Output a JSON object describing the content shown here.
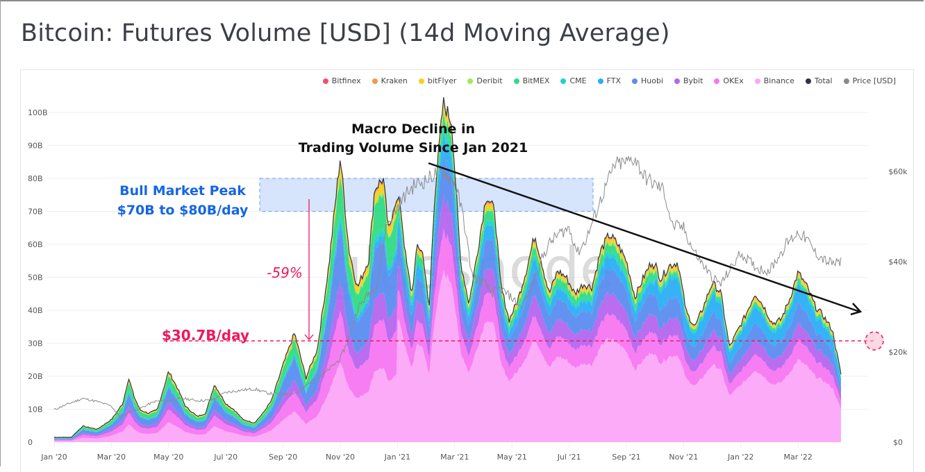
{
  "page": {
    "title": "Bitcoin: Futures Volume [USD] (14d Moving Average)",
    "watermark": "glassnode"
  },
  "legend": [
    {
      "label": "Bitfinex",
      "color": "#f0506e"
    },
    {
      "label": "Kraken",
      "color": "#f7964a"
    },
    {
      "label": "bitFlyer",
      "color": "#f9cf1f"
    },
    {
      "label": "Deribit",
      "color": "#a3ea4f"
    },
    {
      "label": "BitMEX",
      "color": "#2fdc83"
    },
    {
      "label": "CME",
      "color": "#1fd3c6"
    },
    {
      "label": "FTX",
      "color": "#2aaff5"
    },
    {
      "label": "Huobi",
      "color": "#5b8df0"
    },
    {
      "label": "Bybit",
      "color": "#b565ee"
    },
    {
      "label": "OKEx",
      "color": "#f776f2"
    },
    {
      "label": "Binance",
      "color": "#fba6f7"
    },
    {
      "label": "Total",
      "color": "#2f3444"
    },
    {
      "label": "Price [USD]",
      "color": "#8a8a8a"
    }
  ],
  "annotations": {
    "macro_line1": "Macro Decline in",
    "macro_line2": "Trading Volume Since Jan 2021",
    "bull_line1": "Bull Market Peak",
    "bull_line2": "$70B to $80B/day",
    "drop_pct": "-59%",
    "current_level": "$30.7B/day",
    "bull_band_range_B": [
      70,
      80
    ],
    "current_level_B": 30.7
  },
  "chart_data": {
    "type": "area",
    "stacked": true,
    "title": "Bitcoin: Futures Volume [USD] (14d Moving Average)",
    "xlabel": "",
    "ylabel": "",
    "x_ticks": [
      "Jan '20",
      "Mar '20",
      "May '20",
      "Jul '20",
      "Sep '20",
      "Nov '20",
      "Jan '21",
      "Mar '21",
      "May '21",
      "Jul '21",
      "Sep '21",
      "Nov '21",
      "Jan '22",
      "Mar '22"
    ],
    "y_ticks_left": [
      "0",
      "10B",
      "20B",
      "30B",
      "40B",
      "50B",
      "60B",
      "70B",
      "80B",
      "90B",
      "100B"
    ],
    "y_ticks_right": [
      "$0",
      "$20k",
      "$40k",
      "$60k"
    ],
    "ylim_left_B": [
      0,
      100
    ],
    "ylim_right_usd_k": [
      0,
      70
    ],
    "x_month_range": [
      0,
      27.5
    ],
    "grid": true,
    "legend_position": "top-right",
    "total_volume_B": {
      "x_month": [
        0,
        0.6,
        1.0,
        1.5,
        2.0,
        2.4,
        2.6,
        2.8,
        3.0,
        3.3,
        3.6,
        4.0,
        4.3,
        4.6,
        4.8,
        5.0,
        5.3,
        5.6,
        6.0,
        6.3,
        6.6,
        7.0,
        7.3,
        7.6,
        8.0,
        8.4,
        8.8,
        9.2,
        9.6,
        10.0,
        10.3,
        10.6,
        11.0,
        11.2,
        11.5,
        11.7,
        11.9,
        12.1,
        12.3,
        12.5,
        12.7,
        12.9,
        13.1,
        13.3,
        13.6,
        13.9,
        14.2,
        14.5,
        14.8,
        15.1,
        15.4,
        15.6,
        15.9,
        16.2,
        16.5,
        16.8,
        17.0,
        17.3,
        17.6,
        17.9,
        18.2,
        18.5,
        18.8,
        19.1,
        19.4,
        19.7,
        20.0,
        20.3,
        20.6,
        20.9,
        21.2,
        21.5,
        21.8,
        22.1,
        22.4,
        22.7,
        23.0,
        23.3,
        23.6,
        23.9,
        24.2,
        24.5,
        24.8,
        25.1,
        25.4,
        25.7,
        26.0,
        26.3,
        26.6,
        26.9,
        27.2,
        27.5
      ],
      "values": [
        1.5,
        1.5,
        5,
        4,
        7,
        12,
        20,
        14,
        10,
        9,
        10,
        22,
        17,
        11,
        9.5,
        8,
        9,
        18,
        12,
        10,
        7,
        6,
        9,
        13,
        24,
        34,
        20,
        29,
        55,
        89,
        60,
        48,
        57,
        79,
        82,
        65,
        75,
        72,
        55,
        45,
        60,
        57,
        40,
        75,
        103,
        97,
        55,
        42,
        58,
        75,
        70,
        48,
        37,
        43,
        52,
        63,
        56,
        45,
        52,
        50,
        45,
        48,
        47,
        58,
        63,
        60,
        55,
        44,
        50,
        55,
        48,
        52,
        53,
        38,
        34,
        40,
        47,
        44,
        28,
        33,
        38,
        44,
        40,
        35,
        36,
        42,
        50,
        46,
        40,
        37,
        33,
        20
      ]
    },
    "layer_shares": [
      {
        "name": "Binance",
        "share": 0.5
      },
      {
        "name": "OKEx",
        "share": 0.12
      },
      {
        "name": "Bybit",
        "share": 0.1
      },
      {
        "name": "Huobi",
        "share": 0.12
      },
      {
        "name": "FTX",
        "share": 0.06
      },
      {
        "name": "CME",
        "share": 0.02
      },
      {
        "name": "BitMEX",
        "share": 0.04
      },
      {
        "name": "Deribit",
        "share": 0.01
      },
      {
        "name": "bitFlyer",
        "share": 0.02
      },
      {
        "name": "Kraken",
        "share": 0.005
      },
      {
        "name": "Bitfinex",
        "share": 0.005
      }
    ],
    "price_usd_k": {
      "x_month": [
        0,
        0.5,
        1.0,
        1.5,
        2.0,
        2.3,
        2.5,
        2.7,
        3.0,
        3.5,
        4.0,
        4.5,
        5.0,
        5.5,
        6.0,
        6.5,
        7.0,
        7.5,
        8.0,
        8.5,
        9.0,
        9.5,
        10.0,
        10.3,
        10.6,
        11.0,
        11.3,
        11.6,
        12.0,
        12.3,
        12.6,
        13.0,
        13.3,
        13.6,
        14.0,
        14.3,
        14.6,
        14.8,
        15.0,
        15.3,
        15.6,
        16.0,
        16.3,
        16.6,
        17.0,
        17.3,
        17.6,
        18.0,
        18.3,
        18.6,
        19.0,
        19.3,
        19.6,
        20.0,
        20.3,
        20.6,
        21.0,
        21.3,
        21.6,
        22.0,
        22.3,
        22.6,
        23.0,
        23.3,
        23.6,
        24.0,
        24.3,
        24.6,
        25.0,
        25.3,
        25.6,
        26.0,
        26.3,
        26.6,
        27.0,
        27.3,
        27.5
      ],
      "values": [
        7.2,
        8.5,
        9.7,
        9.0,
        8.0,
        5.5,
        6.2,
        7.0,
        7.5,
        9.0,
        9.3,
        9.7,
        9.2,
        9.3,
        11.0,
        11.5,
        11.8,
        10.8,
        10.7,
        11.0,
        13.5,
        15.5,
        18.5,
        23.0,
        29.5,
        33.0,
        35.0,
        48.0,
        52.0,
        55.0,
        57.0,
        58.0,
        59.5,
        60.0,
        57.5,
        50.0,
        37.0,
        36.0,
        35.5,
        33.0,
        34.0,
        32.0,
        30.0,
        33.0,
        40.0,
        44.0,
        46.0,
        47.5,
        42.0,
        45.0,
        52.0,
        57.0,
        61.5,
        62.0,
        63.0,
        59.0,
        57.0,
        56.0,
        48.0,
        47.5,
        43.0,
        40.0,
        36.5,
        35.0,
        38.0,
        42.0,
        40.0,
        38.5,
        38.0,
        41.0,
        44.0,
        46.5,
        45.0,
        42.0,
        40.0,
        39.5,
        40.0
      ]
    }
  }
}
